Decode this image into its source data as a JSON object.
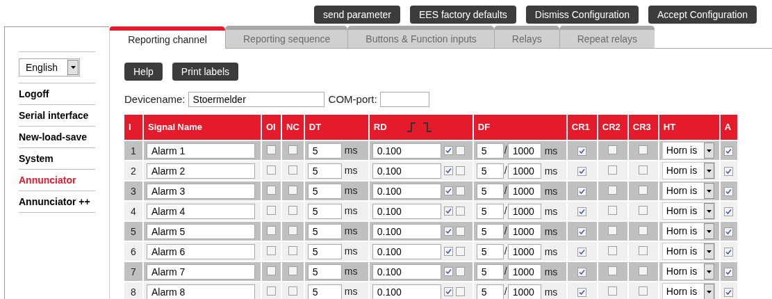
{
  "top_buttons": [
    "send parameter",
    "EES factory defaults",
    "Dismiss Configuration",
    "Accept Configuration"
  ],
  "sidebar": {
    "language": "English",
    "items": [
      {
        "label": "Logoff",
        "selected": false
      },
      {
        "label": "Serial interface",
        "selected": false
      },
      {
        "label": "New-load-save",
        "selected": false
      },
      {
        "label": "System",
        "selected": false
      },
      {
        "label": "Annunciator",
        "selected": true
      },
      {
        "label": "Annunciator ++",
        "selected": false
      }
    ]
  },
  "tabs": [
    {
      "label": "Reporting channel",
      "selected": true
    },
    {
      "label": "Reporting sequence",
      "selected": false
    },
    {
      "label": "Buttons & Function inputs",
      "selected": false
    },
    {
      "label": "Relays",
      "selected": false
    },
    {
      "label": "Repeat relays",
      "selected": false
    }
  ],
  "actions": [
    "Help",
    "Print labels"
  ],
  "device": {
    "label": "Devicename:",
    "value": "Stoermelder",
    "com_label": "COM-port:"
  },
  "table": {
    "columns": [
      "I",
      "Signal Name",
      "OI",
      "NC",
      "DT",
      "RD",
      "DF",
      "CR1",
      "CR2",
      "CR3",
      "HT",
      "A"
    ],
    "rows": [
      {
        "no": "1",
        "name": "Alarm 1",
        "oi": false,
        "nc": false,
        "dt": "5",
        "dt_unit": "ms",
        "rd": "0.100",
        "rd_rise": true,
        "rd_fall": false,
        "df": "5",
        "df_sep": "/",
        "df_div": "1000",
        "df_unit": "ms",
        "cr1": true,
        "cr2": false,
        "cr3": false,
        "ht": "Horn is",
        "a": true
      },
      {
        "no": "2",
        "name": "Alarm 2",
        "oi": false,
        "nc": false,
        "dt": "5",
        "dt_unit": "ms",
        "rd": "0.100",
        "rd_rise": true,
        "rd_fall": false,
        "df": "5",
        "df_sep": "/",
        "df_div": "1000",
        "df_unit": "ms",
        "cr1": true,
        "cr2": false,
        "cr3": false,
        "ht": "Horn is",
        "a": true
      },
      {
        "no": "3",
        "name": "Alarm 3",
        "oi": false,
        "nc": false,
        "dt": "5",
        "dt_unit": "ms",
        "rd": "0.100",
        "rd_rise": true,
        "rd_fall": false,
        "df": "5",
        "df_sep": "/",
        "df_div": "1000",
        "df_unit": "ms",
        "cr1": true,
        "cr2": false,
        "cr3": false,
        "ht": "Horn is",
        "a": true
      },
      {
        "no": "4",
        "name": "Alarm 4",
        "oi": false,
        "nc": false,
        "dt": "5",
        "dt_unit": "ms",
        "rd": "0.100",
        "rd_rise": true,
        "rd_fall": false,
        "df": "5",
        "df_sep": "/",
        "df_div": "1000",
        "df_unit": "ms",
        "cr1": true,
        "cr2": false,
        "cr3": false,
        "ht": "Horn is",
        "a": true
      },
      {
        "no": "5",
        "name": "Alarm 5",
        "oi": false,
        "nc": false,
        "dt": "5",
        "dt_unit": "ms",
        "rd": "0.100",
        "rd_rise": true,
        "rd_fall": false,
        "df": "5",
        "df_sep": "/",
        "df_div": "1000",
        "df_unit": "ms",
        "cr1": true,
        "cr2": false,
        "cr3": false,
        "ht": "Horn is",
        "a": true
      },
      {
        "no": "6",
        "name": "Alarm 6",
        "oi": false,
        "nc": false,
        "dt": "5",
        "dt_unit": "ms",
        "rd": "0.100",
        "rd_rise": true,
        "rd_fall": false,
        "df": "5",
        "df_sep": "/",
        "df_div": "1000",
        "df_unit": "ms",
        "cr1": true,
        "cr2": false,
        "cr3": false,
        "ht": "Horn is",
        "a": true
      },
      {
        "no": "7",
        "name": "Alarm 7",
        "oi": false,
        "nc": false,
        "dt": "5",
        "dt_unit": "ms",
        "rd": "0.100",
        "rd_rise": true,
        "rd_fall": false,
        "df": "5",
        "df_sep": "/",
        "df_div": "1000",
        "df_unit": "ms",
        "cr1": true,
        "cr2": false,
        "cr3": false,
        "ht": "Horn is",
        "a": true
      },
      {
        "no": "8",
        "name": "Alarm 8",
        "oi": false,
        "nc": false,
        "dt": "5",
        "dt_unit": "ms",
        "rd": "0.100",
        "rd_rise": true,
        "rd_fall": false,
        "df": "5",
        "df_sep": "/",
        "df_div": "1000",
        "df_unit": "ms",
        "cr1": true,
        "cr2": false,
        "cr3": false,
        "ht": "Horn is",
        "a": true
      }
    ]
  }
}
